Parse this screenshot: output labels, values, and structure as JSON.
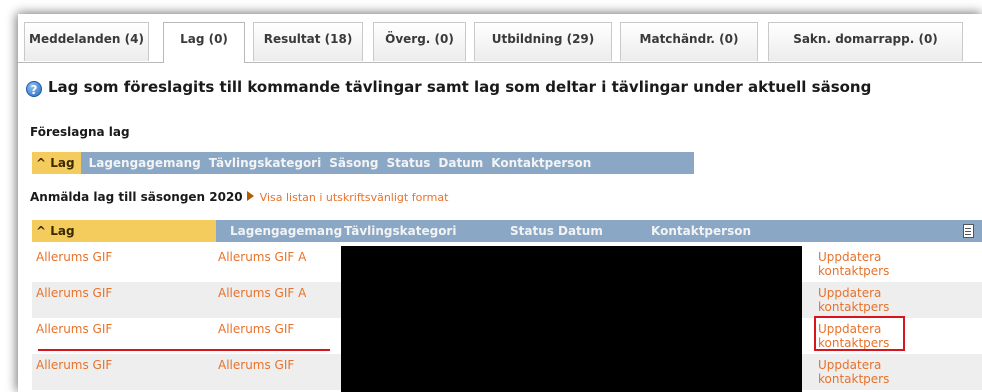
{
  "tabs": [
    {
      "label": "Meddelanden (4)",
      "active": false
    },
    {
      "label": "Lag (0)",
      "active": true
    },
    {
      "label": "Resultat (18)",
      "active": false
    },
    {
      "label": "Överg. (0)",
      "active": false
    },
    {
      "label": "Utbildning (29)",
      "active": false
    },
    {
      "label": "Matchändr. (0)",
      "active": false
    },
    {
      "label": "Sakn. domarrapp. (0)",
      "active": false
    }
  ],
  "heading": "Lag som föreslagits till kommande tävlingar samt lag som deltar i tävlingar under aktuell säsong",
  "proposed": {
    "title": "Föreslagna lag",
    "headers": [
      "Lag",
      "Lagengagemang",
      "Tävlingskategori",
      "Säsong",
      "Status",
      "Datum",
      "Kontaktperson"
    ]
  },
  "registered": {
    "title": "Anmälda lag till säsongen 2020",
    "print_link": "Visa listan i utskriftsvänligt format",
    "headers": [
      "Lag",
      "Lagengagemang",
      "Tävlingskategori",
      "Status",
      "Datum",
      "Kontaktperson"
    ],
    "rows": [
      {
        "lag": "Allerums GIF",
        "engagemang": "Allerums GIF A",
        "action": "Uppdatera kontaktpers"
      },
      {
        "lag": "Allerums GIF",
        "engagemang": "Allerums GIF A",
        "action": "Uppdatera kontaktpers"
      },
      {
        "lag": "Allerums GIF",
        "engagemang": "Allerums GIF",
        "action": "Uppdatera kontaktpers"
      },
      {
        "lag": "Allerums GIF",
        "engagemang": "Allerums GIF",
        "action": "Uppdatera kontaktpers"
      }
    ]
  },
  "colors": {
    "header_bar": "#8aa8c6",
    "sorted_header": "#f4cc5e",
    "link": "#e8722a",
    "annotation": "#d8151f",
    "redaction": "#000000"
  }
}
